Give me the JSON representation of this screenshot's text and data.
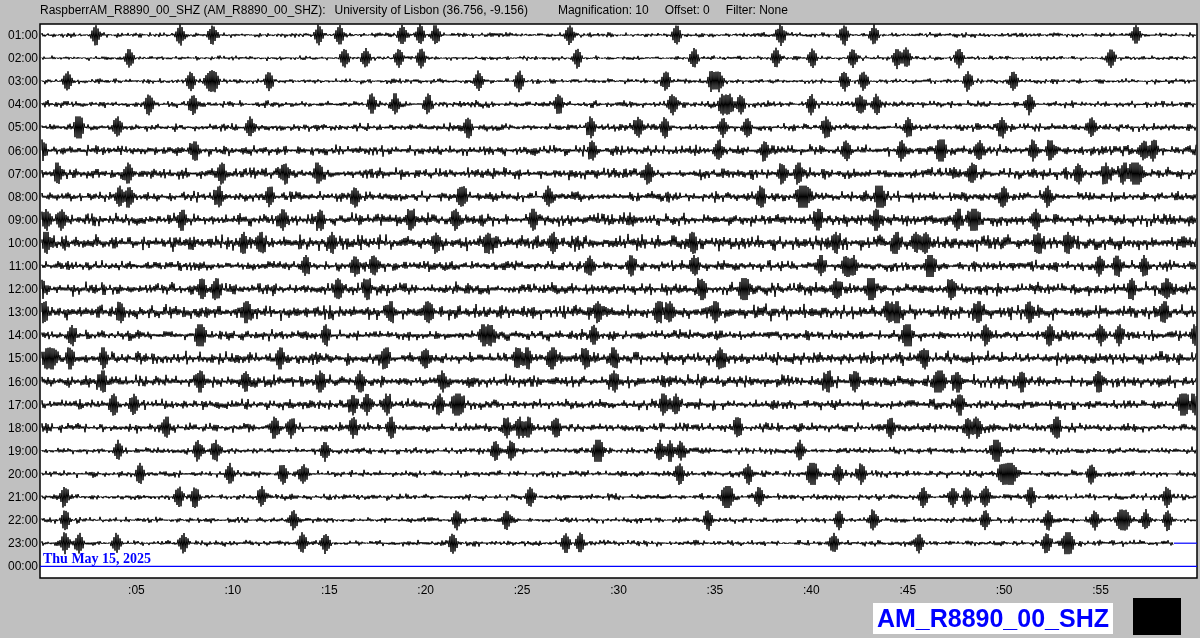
{
  "header": {
    "station": "RaspberrAM_R8890_00_SHZ (AM_R8890_00_SHZ):",
    "location": "University of Lisbon (36.756, -9.156)",
    "magnification": "Magnification: 10",
    "offset": "Offset: 0",
    "filter": "Filter: None"
  },
  "rows": [
    {
      "label": "01:00",
      "kind": "trace"
    },
    {
      "label": "02:00",
      "kind": "trace"
    },
    {
      "label": "03:00",
      "kind": "trace"
    },
    {
      "label": "04:00",
      "kind": "trace"
    },
    {
      "label": "05:00",
      "kind": "trace"
    },
    {
      "label": "06:00",
      "kind": "trace"
    },
    {
      "label": "07:00",
      "kind": "trace"
    },
    {
      "label": "08:00",
      "kind": "trace"
    },
    {
      "label": "09:00",
      "kind": "trace"
    },
    {
      "label": "10:00",
      "kind": "trace"
    },
    {
      "label": "11:00",
      "kind": "trace"
    },
    {
      "label": "12:00",
      "kind": "trace"
    },
    {
      "label": "13:00",
      "kind": "trace"
    },
    {
      "label": "14:00",
      "kind": "trace"
    },
    {
      "label": "15:00",
      "kind": "trace"
    },
    {
      "label": "16:00",
      "kind": "trace"
    },
    {
      "label": "17:00",
      "kind": "trace"
    },
    {
      "label": "18:00",
      "kind": "trace"
    },
    {
      "label": "19:00",
      "kind": "trace"
    },
    {
      "label": "20:00",
      "kind": "trace"
    },
    {
      "label": "21:00",
      "kind": "trace"
    },
    {
      "label": "22:00",
      "kind": "trace"
    },
    {
      "label": "23:00",
      "kind": "partial"
    },
    {
      "label": "00:00",
      "kind": "current"
    }
  ],
  "date": "Thu May 15, 2025",
  "x_ticks": [
    ":05",
    ":10",
    ":15",
    ":20",
    ":25",
    ":30",
    ":35",
    ":40",
    ":45",
    ":50",
    ":55"
  ],
  "station_label": "AM_R8890_00_SHZ"
}
